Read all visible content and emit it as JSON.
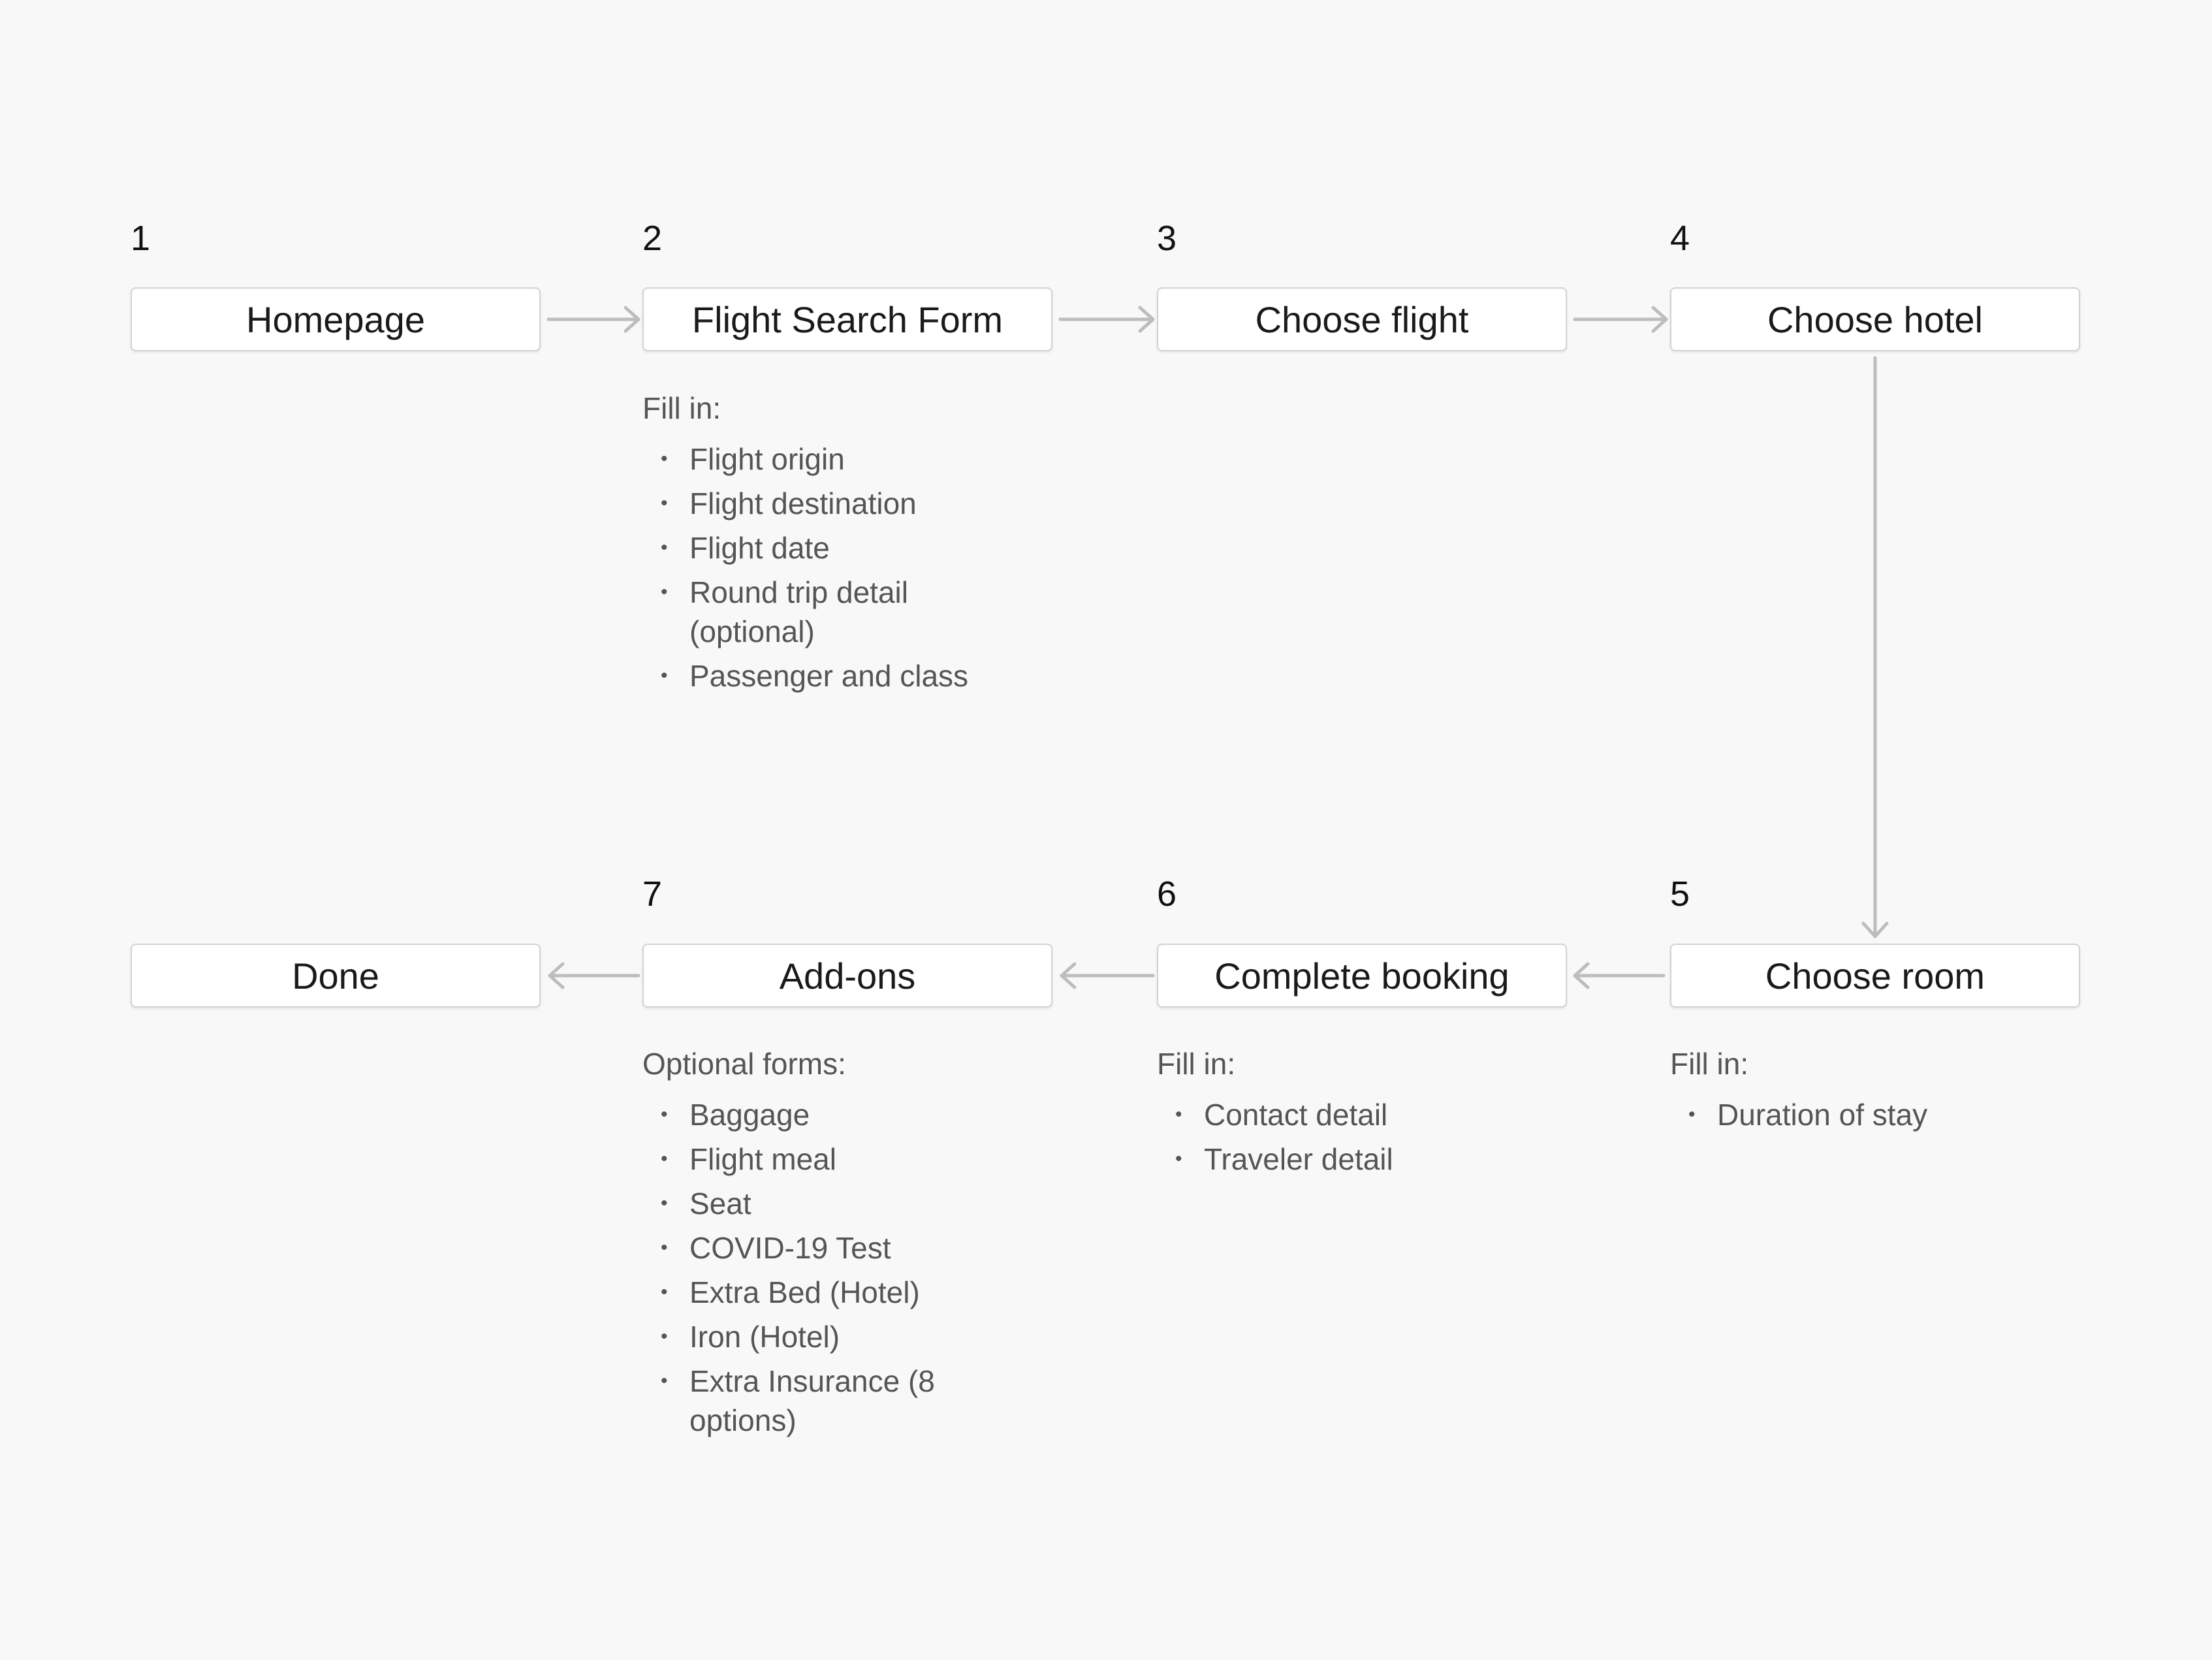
{
  "steps": [
    {
      "number": "1",
      "label": "Homepage"
    },
    {
      "number": "2",
      "label": "Flight Search Form"
    },
    {
      "number": "3",
      "label": "Choose flight"
    },
    {
      "number": "4",
      "label": "Choose hotel"
    },
    {
      "number": "5",
      "label": "Choose room"
    },
    {
      "number": "6",
      "label": "Complete booking"
    },
    {
      "number": "7",
      "label": "Add-ons"
    },
    {
      "number": "",
      "label": "Done"
    }
  ],
  "notes": {
    "flight_search": {
      "heading": "Fill in:",
      "items": [
        "Flight origin",
        "Flight destination",
        "Flight date",
        "Round trip detail (optional)",
        "Passenger and class"
      ]
    },
    "choose_room": {
      "heading": "Fill in:",
      "items": [
        "Duration of stay"
      ]
    },
    "complete_booking": {
      "heading": "Fill in:",
      "items": [
        "Contact detail",
        "Traveler detail"
      ]
    },
    "addons": {
      "heading": "Optional forms:",
      "items": [
        "Baggage",
        "Flight meal",
        "Seat",
        "COVID-19 Test",
        "Extra Bed (Hotel)",
        "Iron (Hotel)",
        "Extra Insurance (8 options)"
      ]
    }
  },
  "colors": {
    "background": "#f8f8f8",
    "box_border": "#d2d2d2",
    "arrow": "#bdbdbd",
    "note_text": "#555555"
  }
}
